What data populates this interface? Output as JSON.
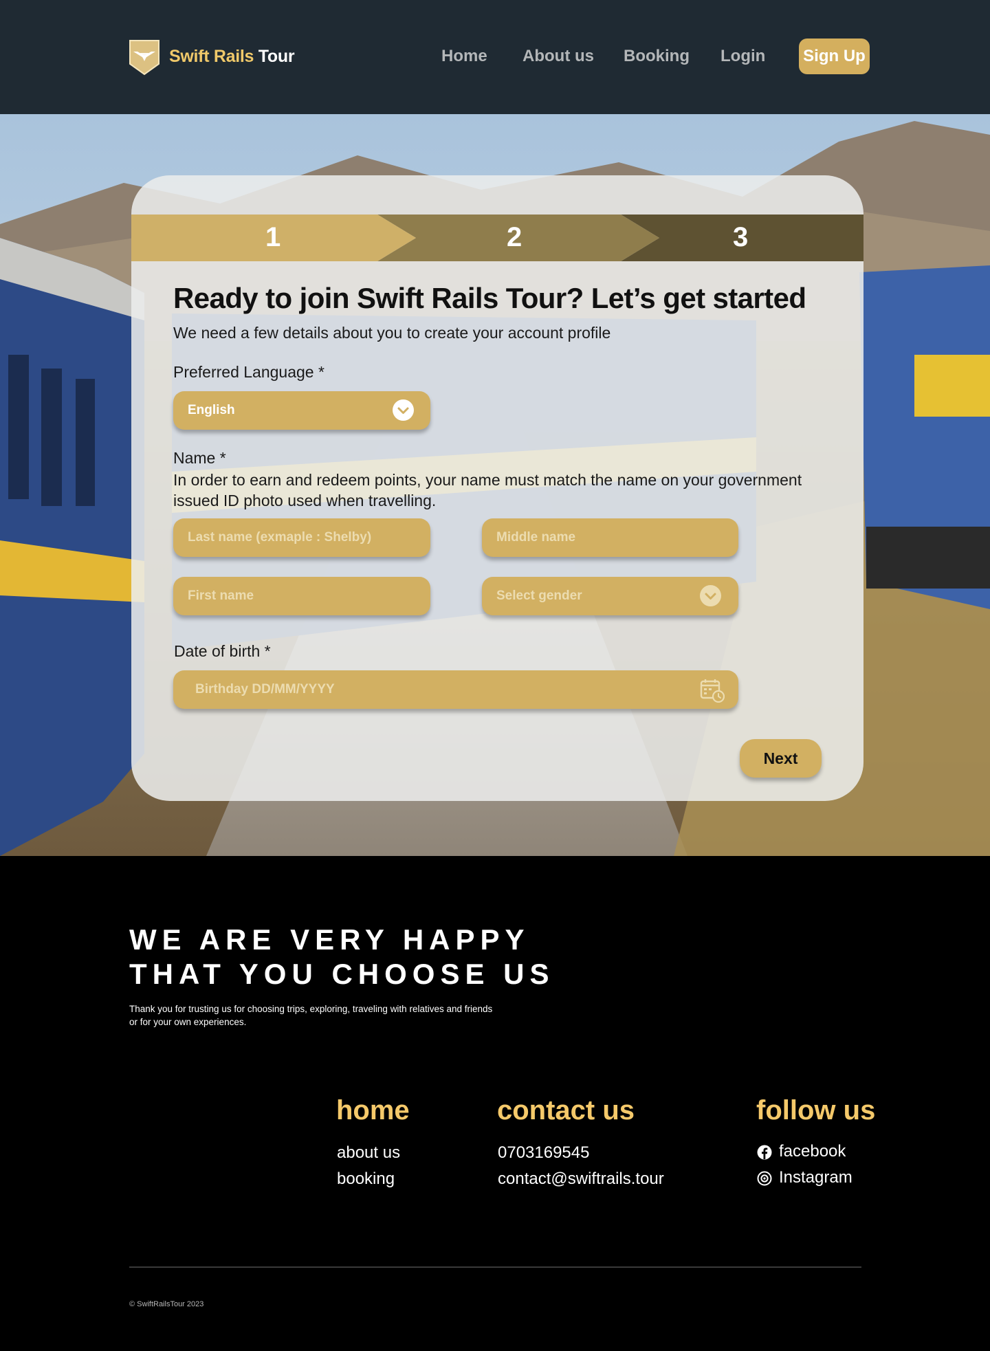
{
  "brand": {
    "name_part1": "Swift Rails",
    "name_part2": "Tour"
  },
  "nav": {
    "home": "Home",
    "about": "About us",
    "booking": "Booking",
    "login": "Login",
    "signup": "Sign Up"
  },
  "steps": [
    "1",
    "2",
    "3"
  ],
  "form": {
    "title": "Ready to join Swift Rails Tour? Let’s get started",
    "subtitle": "We need a few details about you to create your account profile",
    "language_label": "Preferred Language *",
    "language_value": "English",
    "name_label": "Name *",
    "name_note": "In order to earn and redeem points, your name must match the name on your government issued ID photo used when travelling.",
    "last_name_placeholder": "Last name (exmaple : Shelby)",
    "middle_name_placeholder": "Middle name",
    "first_name_placeholder": "First name",
    "gender_placeholder": "Select gender",
    "dob_label": "Date of birth *",
    "dob_placeholder": "Birthday DD/MM/YYYY",
    "next": "Next"
  },
  "footer": {
    "heading_line1": "WE ARE VERY HAPPY",
    "heading_line2": "THAT YOU CHOOSE US",
    "text": "Thank you for trusting us for choosing trips, exploring, traveling with relatives and friends or for your own experiences.",
    "col1": {
      "heading": "home",
      "items": [
        "about us",
        "booking"
      ]
    },
    "col2": {
      "heading": "contact us",
      "items": [
        "0703169545",
        "contact@swiftrails.tour"
      ]
    },
    "col3": {
      "heading": "follow us",
      "items": [
        "facebook",
        "Instagram"
      ]
    },
    "copyright": "© SwiftRailsTour 2023"
  },
  "colors": {
    "header_bg": "#1f2a33",
    "accent_gold": "#d2b062",
    "footer_heading": "#f5c96a",
    "step1": "#cfb068",
    "step2": "#8f7d4c",
    "step3": "#5e5232"
  },
  "icons": [
    "shield-logo-icon",
    "chevron-down-icon",
    "calendar-clock-icon",
    "facebook-icon",
    "instagram-icon"
  ]
}
